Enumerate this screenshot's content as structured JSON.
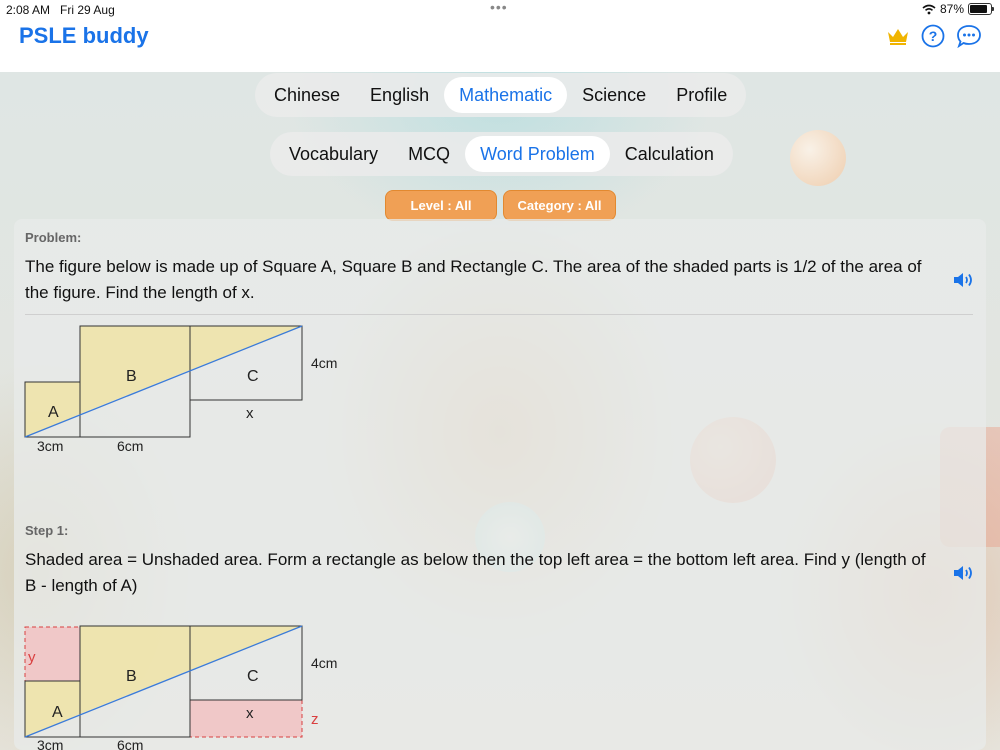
{
  "status_bar": {
    "time": "2:08 AM",
    "date": "Fri 29 Aug",
    "battery": "87%",
    "battery_level": 0.87
  },
  "app": {
    "title": "PSLE buddy"
  },
  "header_icons": [
    "crown-icon",
    "help-icon",
    "chat-icon"
  ],
  "accent_color": "#1a73e8",
  "subject_tabs": {
    "items": [
      "Chinese",
      "English",
      "Mathematic",
      "Science",
      "Profile"
    ],
    "selected": "Mathematic"
  },
  "mode_tabs": {
    "items": [
      "Vocabulary",
      "MCQ",
      "Word Problem",
      "Calculation"
    ],
    "selected": "Word Problem"
  },
  "filters": {
    "level": "Level  :  All",
    "category": "Category  :  All",
    "color": "#f0a055"
  },
  "problem": {
    "label": "Problem:",
    "text": "The figure below is made up of Square A, Square B and Rectangle C. The area of the shaded parts is 1/2 of the area of the figure. Find the length of x.",
    "figure": {
      "labels": {
        "a": "A",
        "b": "B",
        "c": "C",
        "x": "x",
        "side": "4cm",
        "base_a": "3cm",
        "base_b": "6cm"
      }
    }
  },
  "step1": {
    "label": "Step 1:",
    "text": "Shaded area = Unshaded area. Form a rectangle as below then the top left area = the bottom left area. Find y (length of B - length of A)",
    "figure": {
      "labels": {
        "a": "A",
        "b": "B",
        "c": "C",
        "x": "x",
        "y": "y",
        "z": "z",
        "side": "4cm",
        "base_a": "3cm",
        "base_b": "6cm"
      }
    }
  }
}
